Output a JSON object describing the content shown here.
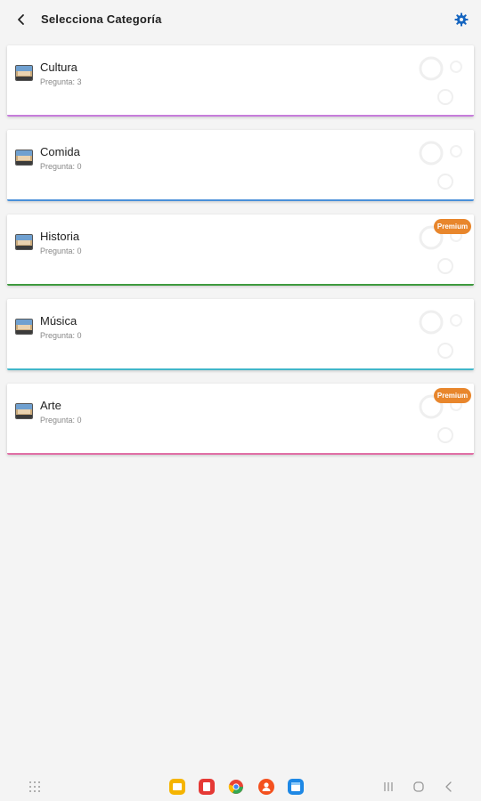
{
  "header": {
    "title": "Selecciona Categoría",
    "back_icon": "back-arrow-icon",
    "settings_icon": "gear-icon",
    "accent_color": "#1565c0"
  },
  "categories": [
    {
      "name": "Cultura",
      "count": "Pregunta: 3",
      "color": "#c77ddb",
      "premium": false
    },
    {
      "name": "Comida",
      "count": "Pregunta: 0",
      "color": "#4a90d9",
      "premium": false
    },
    {
      "name": "Historia",
      "count": "Pregunta: 0",
      "color": "#3f9a3f",
      "premium": true
    },
    {
      "name": "Música",
      "count": "Pregunta: 0",
      "color": "#40b6c9",
      "premium": false
    },
    {
      "name": "Arte",
      "count": "Pregunta: 0",
      "color": "#e06fa5",
      "premium": true
    }
  ],
  "premium_label": "Premium",
  "premium_color": "#e8862c",
  "taskbar": {
    "left_icon": "apps-grid-icon",
    "apps": [
      {
        "icon": "folder-app-icon",
        "color": "#f5b400"
      },
      {
        "icon": "notes-app-icon",
        "color": "#e53935"
      },
      {
        "icon": "chrome-app-icon",
        "color": "#4285f4"
      },
      {
        "icon": "contacts-app-icon",
        "color": "#f4511e"
      },
      {
        "icon": "calendar-app-icon",
        "color": "#1e88e5"
      }
    ],
    "nav": [
      "recents-icon",
      "home-icon",
      "back-icon"
    ]
  }
}
